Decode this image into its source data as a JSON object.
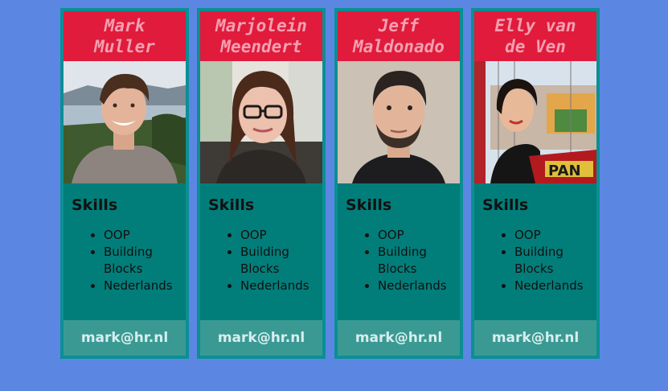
{
  "team": [
    {
      "name": "Mark\nMuller",
      "photo": "portrait-man-lake",
      "skills_heading": "Skills",
      "skills": [
        "OOP",
        "Building Blocks",
        "Nederlands"
      ],
      "email": "mark@hr.nl"
    },
    {
      "name": "Marjolein\nMeendert",
      "photo": "portrait-woman-glasses",
      "skills_heading": "Skills",
      "skills": [
        "OOP",
        "Building Blocks",
        "Nederlands"
      ],
      "email": "mark@hr.nl"
    },
    {
      "name": "Jeff\nMaldonado",
      "photo": "portrait-man-beard",
      "skills_heading": "Skills",
      "skills": [
        "OOP",
        "Building Blocks",
        "Nederlands"
      ],
      "email": "mark@hr.nl"
    },
    {
      "name": "Elly van\nde Ven",
      "photo": "portrait-woman-fairground",
      "skills_heading": "Skills",
      "skills": [
        "OOP",
        "Building Blocks",
        "Nederlands"
      ],
      "email": "mark@hr.nl"
    }
  ],
  "colors": {
    "page_background": "#5b87e3",
    "card_background": "#027e7a",
    "card_border": "#0b8f93",
    "title_background": "#e01b3c",
    "title_text": "#f4a0b0",
    "email_background": "#3a9a93"
  }
}
